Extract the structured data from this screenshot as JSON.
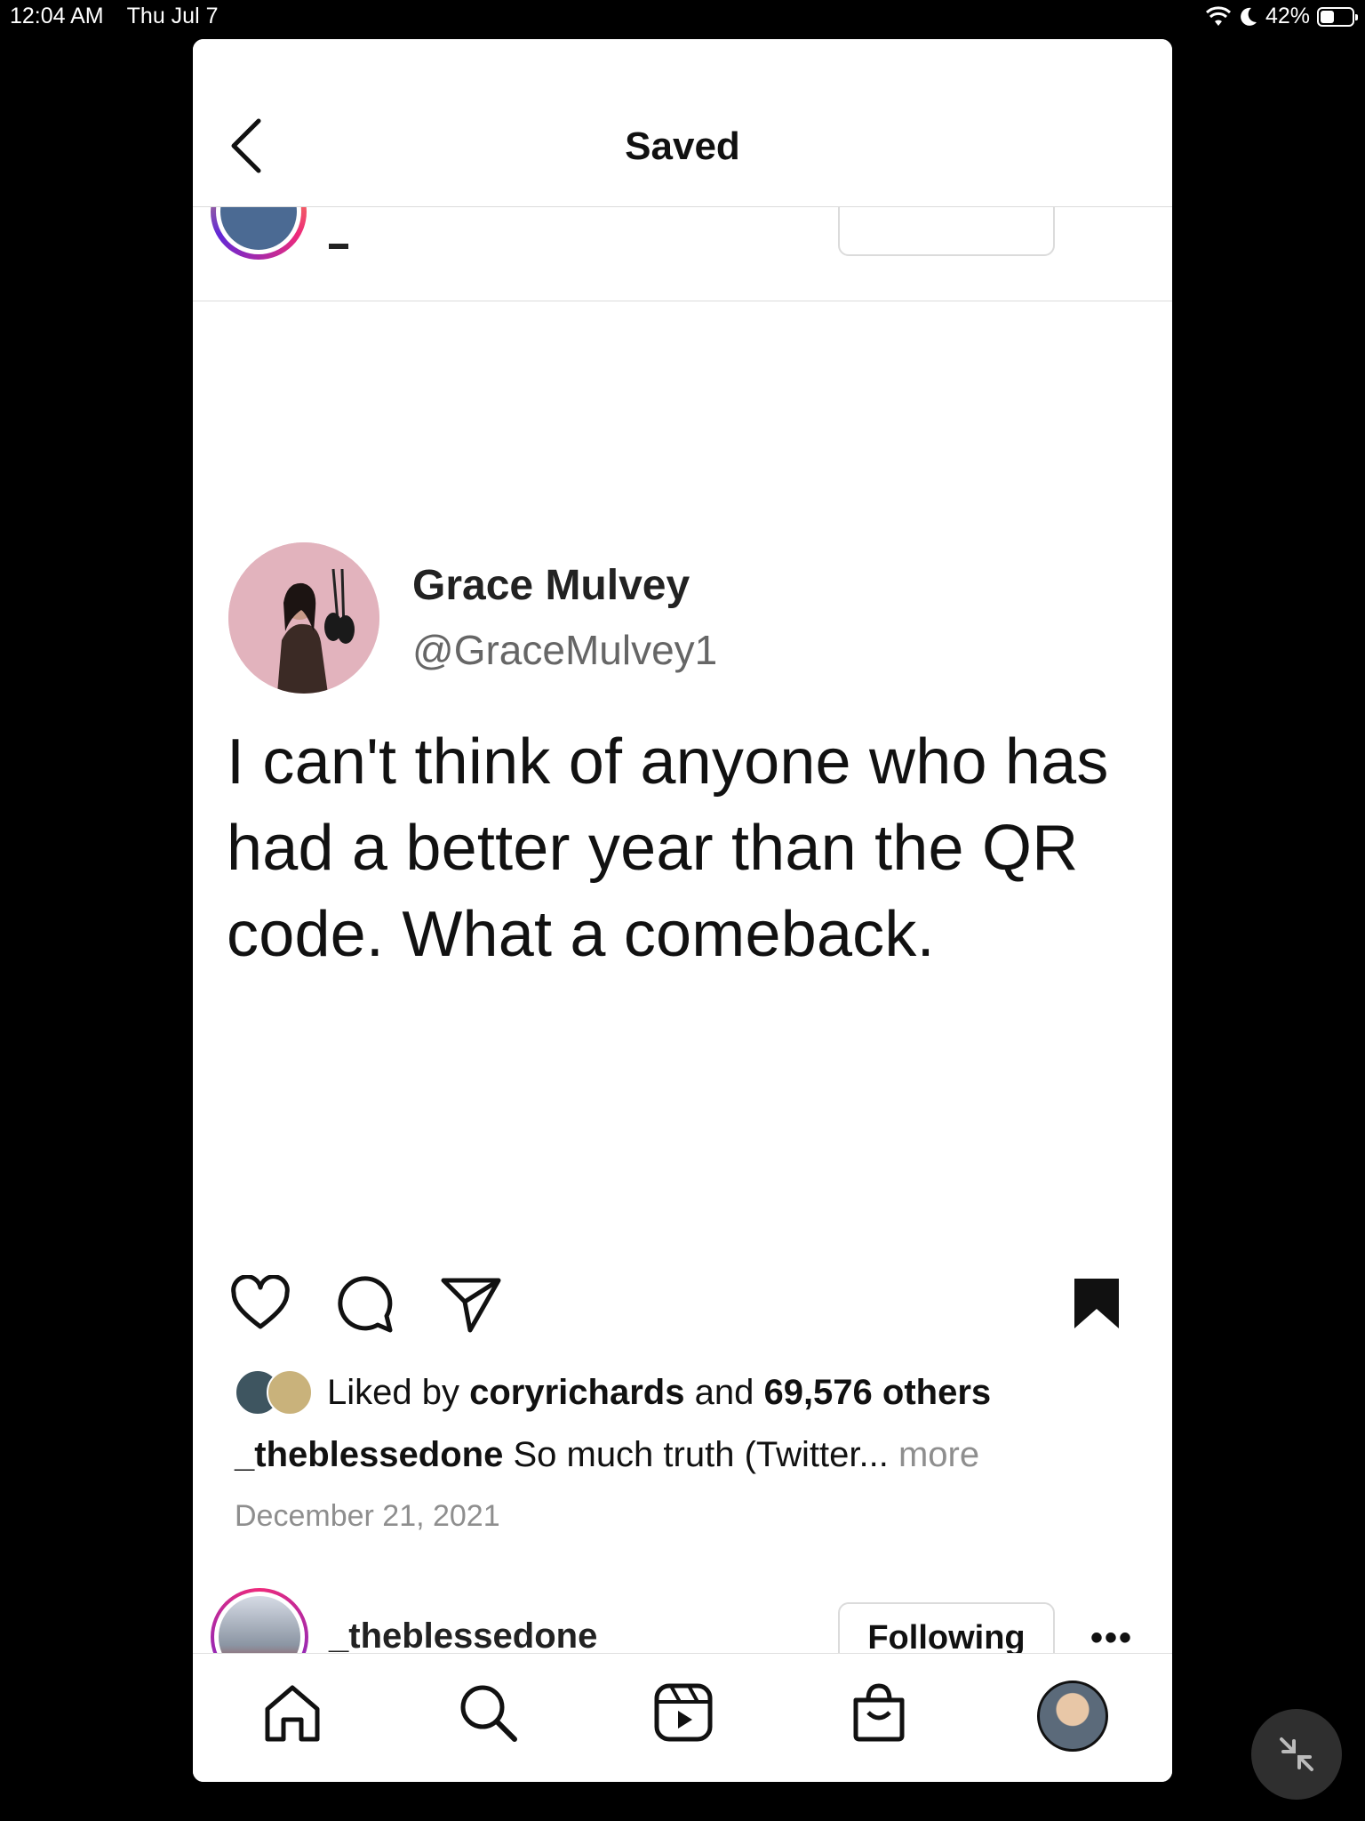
{
  "status_bar": {
    "time": "12:04 AM",
    "date": "Thu Jul 7",
    "battery": "42%",
    "icons": [
      "wifi-icon",
      "moon-icon",
      "battery-icon"
    ]
  },
  "header": {
    "title": "Saved",
    "back_icon": "chevron-left-icon"
  },
  "post": {
    "tweet": {
      "name": "Grace Mulvey",
      "handle": "@GraceMulvey1",
      "text_lines": [
        "I can't think of anyone who has",
        "had a better year than the QR",
        "code. What a comeback."
      ]
    },
    "actions": [
      "heart-icon",
      "comment-icon",
      "share-icon",
      "bookmark-icon"
    ],
    "likes": {
      "prefix": "Liked by",
      "user": "coryrichards",
      "conjunction": "and",
      "others": "69,576 others"
    },
    "caption": {
      "username": "_theblessedone",
      "text": "So much truth (Twitter...",
      "more": "more"
    },
    "date": "December 21, 2021"
  },
  "next_post": {
    "username": "_theblessedone",
    "follow_label": "Following",
    "more": "•••"
  },
  "bottom_nav": [
    "home-icon",
    "search-icon",
    "reels-icon",
    "shop-icon",
    "profile-avatar"
  ],
  "colors": {
    "background": "#000000",
    "panel": "#ffffff",
    "muted_text": "#8e8e8e",
    "border": "#dbdbdb"
  }
}
